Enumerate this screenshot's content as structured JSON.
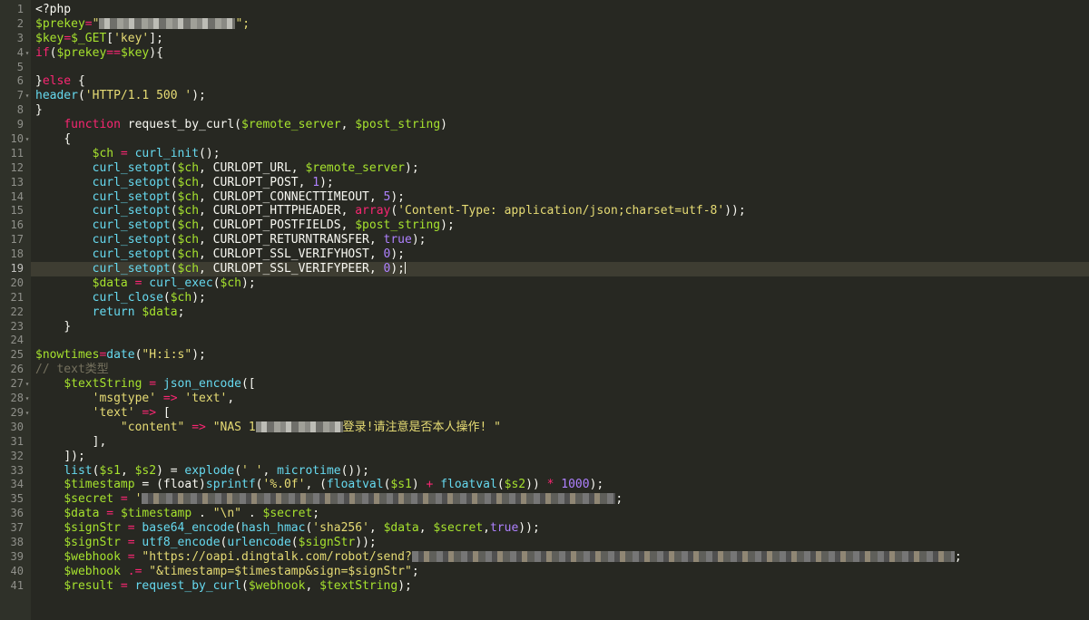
{
  "editor": {
    "line_numbers": [
      "1",
      "2",
      "3",
      "4",
      "5",
      "6",
      "7",
      "8",
      "9",
      "10",
      "11",
      "12",
      "13",
      "14",
      "15",
      "16",
      "17",
      "18",
      "19",
      "20",
      "21",
      "22",
      "23",
      "24",
      "25",
      "26",
      "27",
      "28",
      "29",
      "30",
      "31",
      "32",
      "33",
      "34",
      "35",
      "36",
      "37",
      "38",
      "39",
      "40",
      "41"
    ],
    "fold_markers": {
      "4": "▾",
      "7": "▾",
      "10": "▾",
      "27": "▾",
      "28": "▾",
      "29": "▾"
    },
    "active_line": "19",
    "lines": {
      "l1_open": "<?php",
      "l2_var": "$prekey",
      "l2_eq": "=",
      "l2_q1": "\"",
      "l2_q2": "\";",
      "l3_var": "$key",
      "l3_eq": "=",
      "l3_get": "$_GET",
      "l3_b1": "[",
      "l3_key": "'key'",
      "l3_b2": "];",
      "l4_if": "if",
      "l4_p1": "(",
      "l4_v1": "$prekey",
      "l4_op": "==",
      "l4_v2": "$key",
      "l4_p2": "){",
      "l6_close": "}",
      "l6_else": "else",
      "l6_brace": " {",
      "l7_header": "header",
      "l7_p1": "(",
      "l7_str": "'HTTP/1.1 500 '",
      "l7_p2": ");",
      "l8": "}",
      "l9_function": "function",
      "l9_name": " request_by_curl(",
      "l9_a1": "$remote_server",
      "l9_comma": ", ",
      "l9_a2": "$post_string",
      "l9_end": ")",
      "l10": "{",
      "l11_v": "$ch",
      "l11_eq": " = ",
      "l11_f": "curl_init",
      "l11_end": "();",
      "l12_f": "curl_setopt",
      "l12_rest1": "(",
      "l12_ch": "$ch",
      "l12_const": ", CURLOPT_URL, ",
      "l12_arg": "$remote_server",
      "l12_end": ");",
      "l13_f": "curl_setopt",
      "l13_p": "(",
      "l13_ch": "$ch",
      "l13_const": ", CURLOPT_POST, ",
      "l13_num": "1",
      "l13_end": ");",
      "l14_f": "curl_setopt",
      "l14_p": "(",
      "l14_ch": "$ch",
      "l14_const": ", CURLOPT_CONNECTTIMEOUT, ",
      "l14_num": "5",
      "l14_end": ");",
      "l15_f": "curl_setopt",
      "l15_p": "(",
      "l15_ch": "$ch",
      "l15_const": ", CURLOPT_HTTPHEADER, ",
      "l15_arr": "array",
      "l15_p2": "(",
      "l15_str": "'Content-Type: application/json;charset=utf-8'",
      "l15_end": "));",
      "l16_f": "curl_setopt",
      "l16_p": "(",
      "l16_ch": "$ch",
      "l16_const": ", CURLOPT_POSTFIELDS, ",
      "l16_arg": "$post_string",
      "l16_end": ");",
      "l17_f": "curl_setopt",
      "l17_p": "(",
      "l17_ch": "$ch",
      "l17_const": ", CURLOPT_RETURNTRANSFER, ",
      "l17_num": "true",
      "l17_end": ");",
      "l18_f": "curl_setopt",
      "l18_p": "(",
      "l18_ch": "$ch",
      "l18_const": ", CURLOPT_SSL_VERIFYHOST, ",
      "l18_num": "0",
      "l18_end": ");",
      "l19_f": "curl_setopt",
      "l19_p": "(",
      "l19_ch": "$ch",
      "l19_const": ", CURLOPT_SSL_VERIFYPEER, ",
      "l19_num": "0",
      "l19_end": ");",
      "l20_v": "$data",
      "l20_eq": " = ",
      "l20_f": "curl_exec",
      "l20_p": "(",
      "l20_ch": "$ch",
      "l20_end": ");",
      "l21_f": "curl_close",
      "l21_p": "(",
      "l21_ch": "$ch",
      "l21_end": ");",
      "l22_ret": "return",
      "l22_sp": " ",
      "l22_v": "$data",
      "l22_end": ";",
      "l23": "}",
      "l25_v": "$nowtimes",
      "l25_eq": "=",
      "l25_f": "date",
      "l25_p": "(",
      "l25_str": "\"H:i:s\"",
      "l25_end": ");",
      "l26_comment": "// text类型",
      "l27_v": "$textString",
      "l27_eq": " = ",
      "l27_f": "json_encode",
      "l27_end": "([",
      "l28_str": "'msgtype'",
      "l28_arrow": " => ",
      "l28_val": "'text'",
      "l28_end": ",",
      "l29_str": "'text'",
      "l29_arrow": " => ",
      "l29_end": "[",
      "l30_str": "\"content\"",
      "l30_arrow": " => ",
      "l30_val_a": "\"NAS 1",
      "l30_val_b": "登录!请注意是否本人操作! \"",
      "l31": "],",
      "l32": "]);",
      "l33_f": "list",
      "l33_p": "(",
      "l33_v1": "$s1",
      "l33_c": ", ",
      "l33_v2": "$s2",
      "l33_p2": ") = ",
      "l33_f2": "explode",
      "l33_p3": "(",
      "l33_str": "' '",
      "l33_c2": ", ",
      "l33_f3": "microtime",
      "l33_end": "());",
      "l34_v": "$timestamp",
      "l34_eq": " = (float)",
      "l34_f": "sprintf",
      "l34_p": "(",
      "l34_str": "'%.0f'",
      "l34_c": ", (",
      "l34_f2": "floatval",
      "l34_p2": "(",
      "l34_v2": "$s1",
      "l34_p3": ") ",
      "l34_plus": "+",
      "l34_sp": " ",
      "l34_f3": "floatval",
      "l34_p4": "(",
      "l34_v3": "$s2",
      "l34_p5": ")) ",
      "l34_mul": "*",
      "l34_sp2": " ",
      "l34_num": "1000",
      "l34_end": ");",
      "l35_v": "$secret",
      "l35_eq": " = ",
      "l35_q": "'",
      "l35_end": ";",
      "l36_v": "$data",
      "l36_eq": " = ",
      "l36_v2": "$timestamp",
      "l36_dot": " . ",
      "l36_str": "\"\\n\"",
      "l36_dot2": " . ",
      "l36_v3": "$secret",
      "l36_end": ";",
      "l37_v": "$signStr",
      "l37_eq": " = ",
      "l37_f": "base64_encode",
      "l37_p": "(",
      "l37_f2": "hash_hmac",
      "l37_p2": "(",
      "l37_str": "'sha256'",
      "l37_c": ", ",
      "l37_v2": "$data",
      "l37_c2": ", ",
      "l37_v3": "$secret",
      "l37_c3": ",",
      "l37_t": "true",
      "l37_end": "));",
      "l38_v": "$signStr",
      "l38_eq": " = ",
      "l38_f": "utf8_encode",
      "l38_p": "(",
      "l38_f2": "urlencode",
      "l38_p2": "(",
      "l38_v2": "$signStr",
      "l38_end": "));",
      "l39_v": "$webhook",
      "l39_eq": " = ",
      "l39_str": "\"https://oapi.dingtalk.com/robot/send?",
      "l39_end": ";",
      "l40_v": "$webhook",
      "l40_eq": " .= ",
      "l40_str": "\"&timestamp=$timestamp&sign=$signStr\"",
      "l40_end": ";",
      "l41_v": "$result",
      "l41_eq": " = ",
      "l41_f": "request_by_curl",
      "l41_p": "(",
      "l41_v2": "$webhook",
      "l41_c": ", ",
      "l41_v3": "$textString",
      "l41_end": ");"
    }
  }
}
